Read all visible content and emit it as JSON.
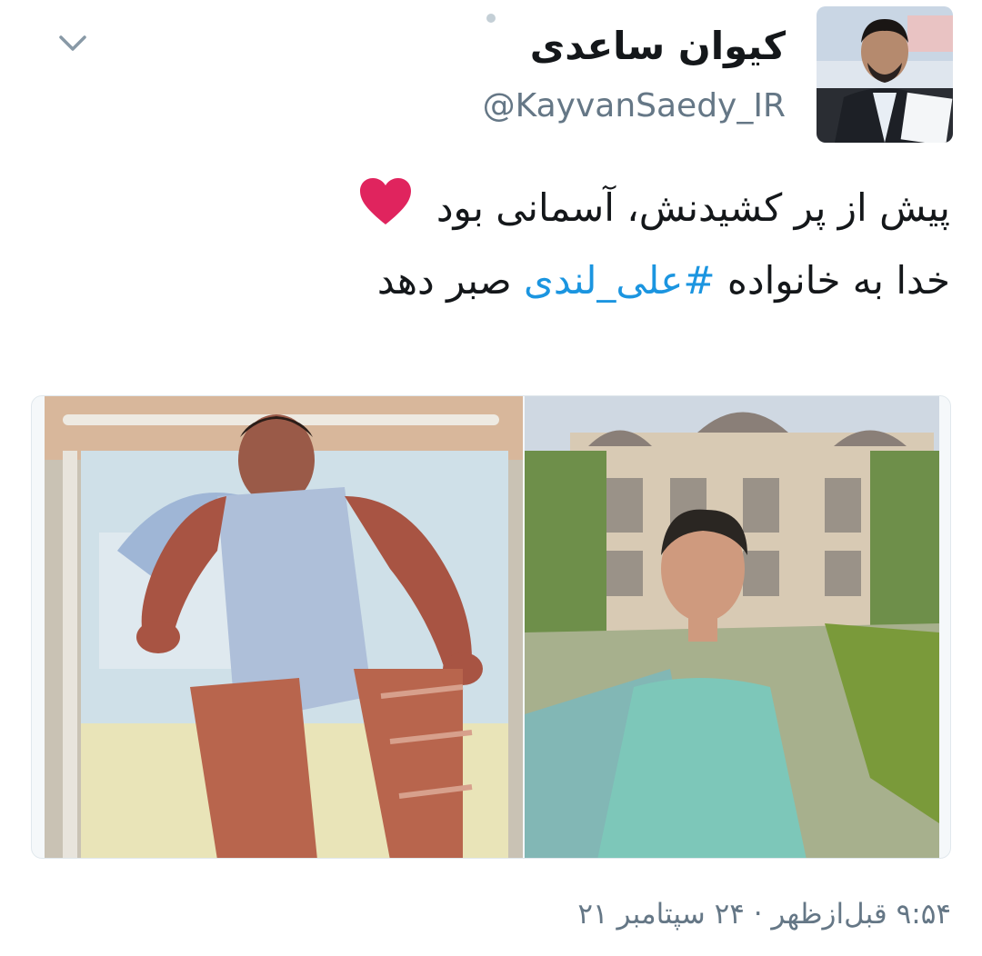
{
  "tweet": {
    "author": {
      "display_name": "کیوان ساعدی",
      "handle": "@KayvanSaedy_IR",
      "avatar": "avatar-photo"
    },
    "text_line_1": "پیش از پر کشیدنش، آسمانی بود",
    "text_line_2_before": "خدا به خانواده ",
    "hashtag": "#علی_لندی",
    "text_line_2_after": " صبر دهد",
    "emoji": "red-heart-icon",
    "media": [
      {
        "name": "hospital-bed-photo"
      },
      {
        "name": "garden-portrait-photo"
      }
    ],
    "timestamp": "۹:۵۴ قبل‌ازظهر · ۲۴ سپتامبر ۲۱"
  },
  "colors": {
    "text": "#14171a",
    "secondary": "#657786",
    "link": "#1b95e0",
    "heart": "#e0245e"
  },
  "icons": {
    "caret": "chevron-down-icon"
  }
}
